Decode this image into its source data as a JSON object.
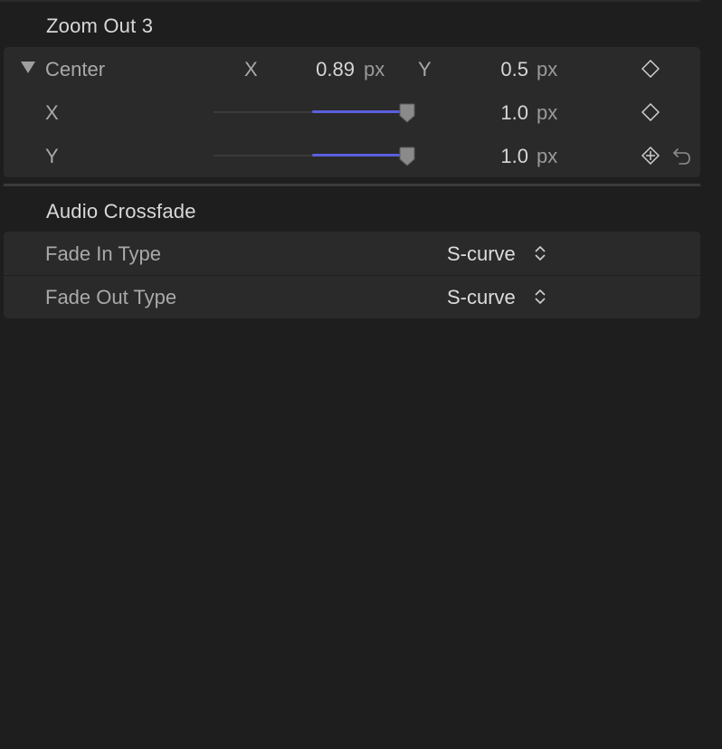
{
  "sections": {
    "zoom": {
      "title": "Zoom Out 3",
      "center": {
        "label": "Center",
        "x_axis": "X",
        "x_value": "0.89",
        "x_unit": "px",
        "y_axis": "Y",
        "y_value": "0.5",
        "y_unit": "px"
      },
      "x_row": {
        "label": "X",
        "value": "1.0",
        "unit": "px",
        "slider_fraction": 0.95
      },
      "y_row": {
        "label": "Y",
        "value": "1.0",
        "unit": "px",
        "slider_fraction": 0.95
      }
    },
    "audio": {
      "title": "Audio Crossfade",
      "fade_in": {
        "label": "Fade In Type",
        "value": "S-curve"
      },
      "fade_out": {
        "label": "Fade Out Type",
        "value": "S-curve"
      }
    }
  },
  "icons": {
    "disclosure": "triangle-down-icon",
    "keyframe": "diamond-icon",
    "add_keyframe": "diamond-plus-icon",
    "reset": "reset-arrow-icon",
    "popup": "updown-chevron-icon"
  },
  "colors": {
    "background": "#1e1e1e",
    "panel": "#2a2a2a",
    "slider_fill": "#5b5fe0"
  }
}
